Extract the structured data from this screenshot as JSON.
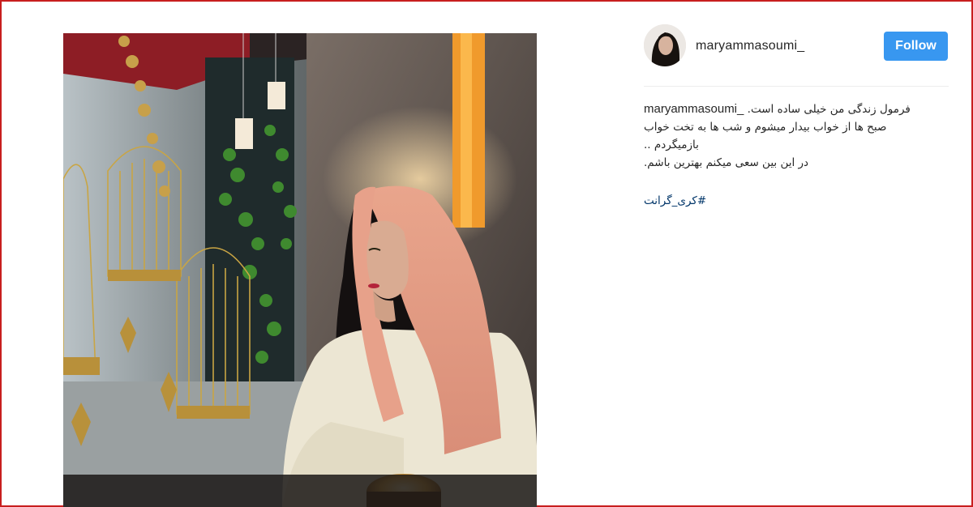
{
  "post": {
    "username": "maryammasoumi_",
    "follow_label": "Follow",
    "caption": {
      "author": "maryammasoumi_",
      "first_line": "فرمول زندگی من خیلی ساده است.",
      "lines": [
        "صبح ها از خواب بیدار میشوم و شب ها به تخت خواب",
        "بازمیگردم ..",
        "در این بین سعی میکنم بهترین باشم."
      ]
    },
    "hashtag": "#کری_گرانت"
  },
  "colors": {
    "frame_border": "#c81e1e",
    "follow_button": "#3897f0",
    "hashtag": "#003569"
  },
  "icons": {
    "photo": "woman-in-peach-scarf-photo",
    "avatar": "profile-avatar"
  }
}
